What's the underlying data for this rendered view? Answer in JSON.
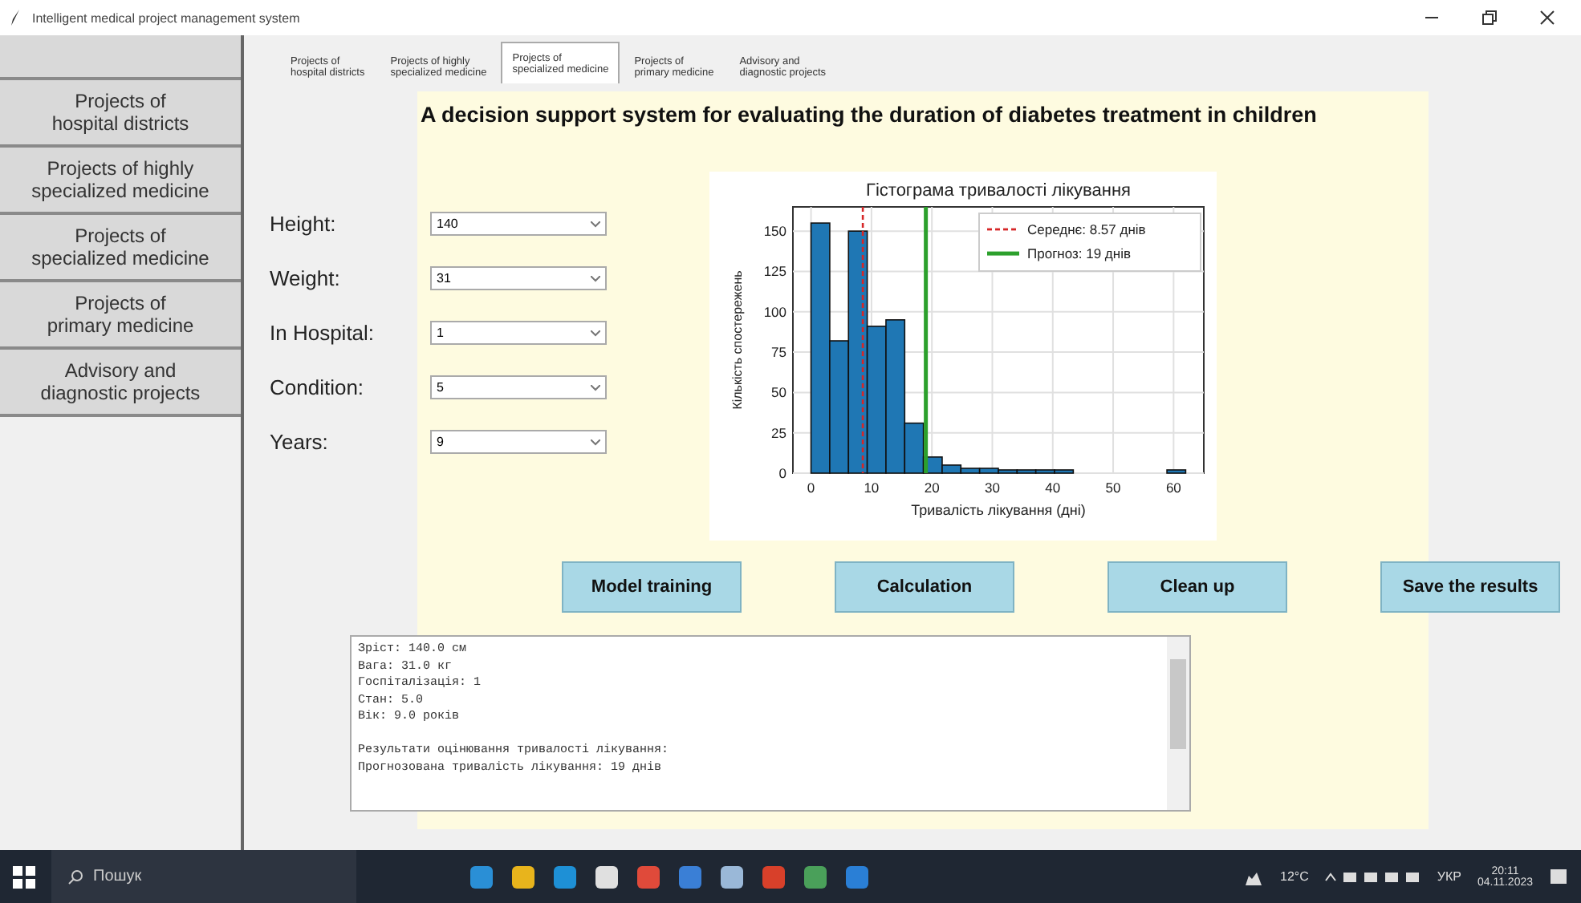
{
  "window": {
    "title": "Intelligent medical project management system"
  },
  "tabs": [
    {
      "label": "Projects of\nhospital districts",
      "selected": false
    },
    {
      "label": "Projects of highly\nspecialized medicine",
      "selected": false
    },
    {
      "label": "Projects of\nspecialized medicine",
      "selected": true
    },
    {
      "label": "Projects of\nprimary medicine",
      "selected": false
    },
    {
      "label": "Advisory and\ndiagnostic projects",
      "selected": false
    }
  ],
  "sidebar": {
    "items": [
      {
        "label": "Projects of\nhospital districts"
      },
      {
        "label": "Projects of highly\nspecialized medicine"
      },
      {
        "label": "Projects of\nspecialized medicine"
      },
      {
        "label": "Projects of\nprimary medicine"
      },
      {
        "label": "Advisory and\ndiagnostic projects"
      }
    ]
  },
  "heading": "A decision support system for evaluating the duration of diabetes treatment in children",
  "fields": [
    {
      "label": "Height:",
      "value": "140"
    },
    {
      "label": "Weight:",
      "value": "31"
    },
    {
      "label": "In Hospital:",
      "value": "1"
    },
    {
      "label": "Condition:",
      "value": "5"
    },
    {
      "label": "Years:",
      "value": "9"
    }
  ],
  "chart": {
    "chart_data": {
      "type": "bar",
      "title": "Гістограма тривалості лікування",
      "xlabel": "Тривалість лікування (дні)",
      "ylabel": "Кількість спостережень",
      "x": [
        1.55,
        4.65,
        7.75,
        10.85,
        13.95,
        17.05,
        20.15,
        23.25,
        26.35,
        29.45,
        32.55,
        35.65,
        38.75,
        41.85,
        44.95,
        48.05,
        51.15,
        54.25,
        57.35,
        60.45
      ],
      "grid": true,
      "series": [
        {
          "color": "#1f77b4",
          "values": [
            155,
            82,
            150,
            91,
            95,
            31,
            10,
            5,
            3,
            3,
            2,
            2,
            2,
            2,
            0,
            0,
            0,
            0,
            0,
            2
          ]
        }
      ],
      "xlim": [
        -3,
        65
      ],
      "ylim": [
        0,
        165
      ],
      "xticks": [
        0,
        10,
        20,
        30,
        40,
        50,
        60
      ],
      "yticks": [
        0,
        25,
        50,
        75,
        100,
        125,
        150
      ],
      "ref_lines": [
        {
          "axis": "x",
          "value": 8.57,
          "color": "#d62728"
        },
        {
          "axis": "x",
          "value": 19,
          "color": "#2ca02c"
        }
      ]
    },
    "legend": [
      {
        "label": "Середнє: 8.57 днів",
        "color": "#d62728"
      },
      {
        "label": "Прогноз: 19 днів",
        "color": "#2ca02c"
      }
    ]
  },
  "buttons": [
    "Model training",
    "Calculation",
    "Clean up",
    "Save the results"
  ],
  "output": {
    "paragraphs": [
      [
        "Зріст: 140.0 см",
        "Вага: 31.0 кг",
        "Госпіталізація: 1",
        "Стан: 5.0",
        "Вік: 9.0 років"
      ],
      [
        "Результати оцінювання тривалості лікування:",
        "Прогнозована тривалість лікування: 19 днів"
      ]
    ]
  },
  "taskbar": {
    "search_placeholder": "Пошук",
    "weather": "12°C",
    "language": "УКР",
    "time": "20:11",
    "date": "04.11.2023"
  }
}
